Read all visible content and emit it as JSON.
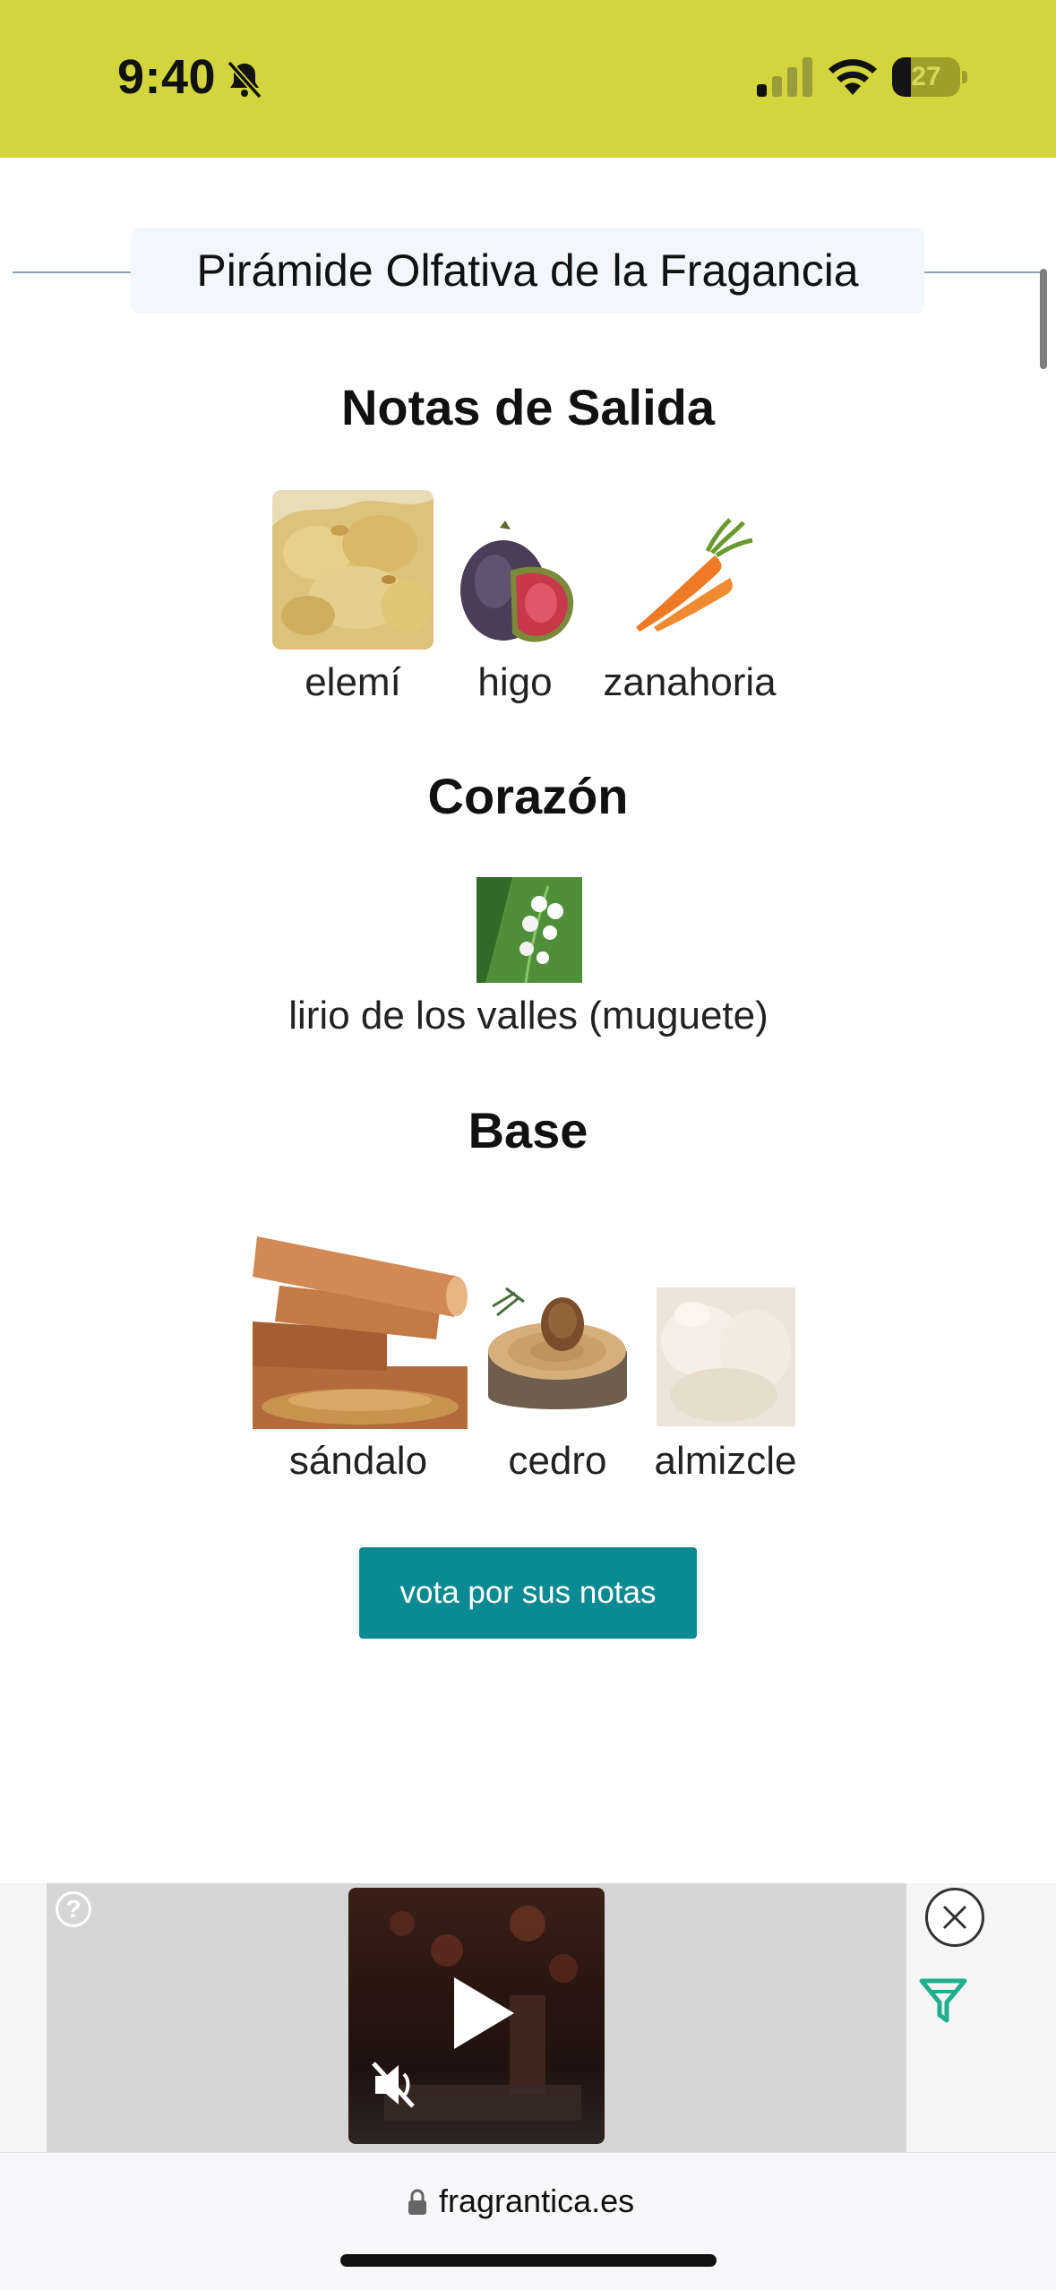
{
  "status_bar": {
    "time": "9:40",
    "battery_level": "27",
    "battery_fraction": 0.27,
    "background_color": "#d2d53c",
    "icons": [
      "bell-slash-icon",
      "cellular-signal-icon",
      "wifi-icon",
      "battery-icon"
    ]
  },
  "pyramid": {
    "title": "Pirámide Olfativa de la Fragancia",
    "sections": [
      {
        "title": "Notas de Salida",
        "notes": [
          "elemí",
          "higo",
          "zanahoria"
        ]
      },
      {
        "title": "Corazón",
        "notes": [
          "lirio de los valles (muguete)"
        ]
      },
      {
        "title": "Base",
        "notes": [
          "sándalo",
          "cedro",
          "almizcle"
        ]
      }
    ]
  },
  "vote_button": {
    "label": "vota por sus notas",
    "color": "#0b8a92"
  },
  "ad": {
    "help_symbol": "?",
    "icons": [
      "help-icon",
      "play-icon",
      "muted-speaker-icon",
      "close-icon",
      "filter-icon"
    ]
  },
  "url_bar": {
    "domain": "fragrantica.es"
  }
}
